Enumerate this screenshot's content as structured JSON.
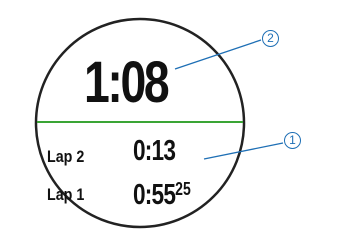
{
  "watch": {
    "main_time": "1:08",
    "laps": [
      {
        "label": "Lap 2",
        "time": "0:13",
        "hundredths": ""
      },
      {
        "label": "Lap 1",
        "time": "0:55",
        "hundredths": "25"
      }
    ]
  },
  "callouts": [
    {
      "number": "1"
    },
    {
      "number": "2"
    }
  ],
  "colors": {
    "bezel": "#222222",
    "divider": "#3aa535",
    "callout": "#1e6fb5",
    "text": "#111111"
  }
}
